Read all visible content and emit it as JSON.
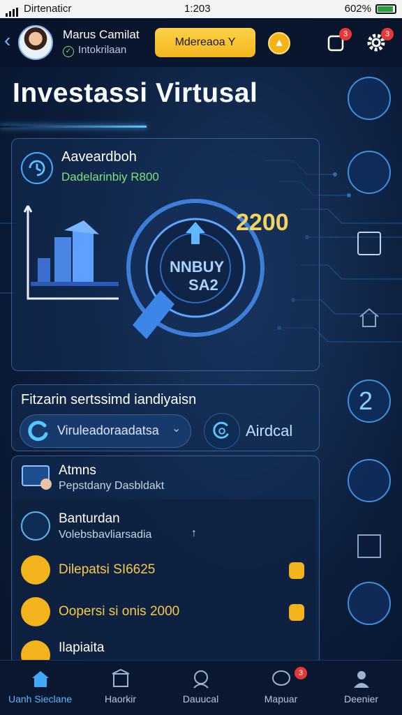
{
  "status_bar": {
    "carrier": "Dirtenaticr",
    "time": "1:203",
    "battery": "602%"
  },
  "header": {
    "user_name": "Marus Camilat",
    "user_sub": "Intokrilaan",
    "badge_button": "Mdereaoa Y",
    "notifications_count": "3",
    "settings_count": "3"
  },
  "page": {
    "title": "Investassi Virtusal"
  },
  "hero": {
    "title": "Aaveardboh",
    "subtitle": "Dadelarinbiy R800",
    "amount": "2200",
    "dial_line1": "NNBUY",
    "dial_line2": "SA2"
  },
  "filter": {
    "title": "Fitzarin sertssimd iandiyaisn",
    "select_value": "Viruleadoraadatsa",
    "right_label": "Airdcal"
  },
  "list": {
    "header_title": "Atmns",
    "header_sub": "Pepstdany Dasbldakt",
    "items": [
      {
        "title": "Banturdan",
        "sub": "Volebsbavliarsadia"
      },
      {
        "title": "Dilepatsi SI6625"
      },
      {
        "title": "Oopersi si onis 2000"
      },
      {
        "title": "Ilapiaita"
      }
    ]
  },
  "rail": {
    "number": "2"
  },
  "bottom_nav": {
    "items": [
      {
        "label": "Uanh Sieclane"
      },
      {
        "label": "Haorkir"
      },
      {
        "label": "Dauucal"
      },
      {
        "label": "Mapuar"
      },
      {
        "label": "Deenier"
      }
    ],
    "badge": "3"
  }
}
